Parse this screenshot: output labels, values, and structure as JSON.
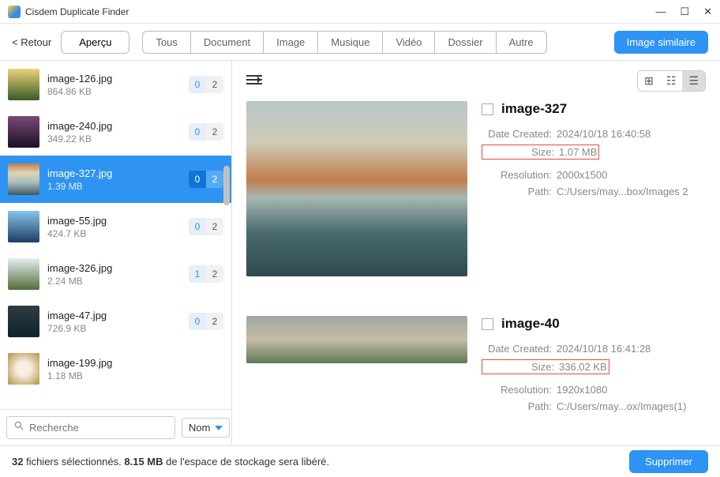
{
  "titlebar": {
    "title": "Cisdem Duplicate Finder"
  },
  "toolbar": {
    "back": "< Retour",
    "apercu": "Aperçu",
    "tabs": [
      "Tous",
      "Document",
      "Image",
      "Musique",
      "Vidéo",
      "Dossier",
      "Autre"
    ],
    "similar": "Image similaire"
  },
  "sidebar": {
    "items": [
      {
        "name": "image-126.jpg",
        "size": "864.86 KB",
        "c0": "0",
        "c1": "2"
      },
      {
        "name": "image-240.jpg",
        "size": "349.22 KB",
        "c0": "0",
        "c1": "2"
      },
      {
        "name": "image-327.jpg",
        "size": "1.39 MB",
        "c0": "0",
        "c1": "2"
      },
      {
        "name": "image-55.jpg",
        "size": "424.7 KB",
        "c0": "0",
        "c1": "2"
      },
      {
        "name": "image-326.jpg",
        "size": "2.24 MB",
        "c0": "1",
        "c1": "2"
      },
      {
        "name": "image-47.jpg",
        "size": "726.9 KB",
        "c0": "0",
        "c1": "2"
      },
      {
        "name": "image-199.jpg",
        "size": "1.18 MB",
        "c0": "",
        "c1": ""
      }
    ],
    "search_placeholder": "Recherche",
    "sort": "Nom"
  },
  "viewmode": {
    "grid": "⊞",
    "col": "☷",
    "list": "☰"
  },
  "filter_icon": "≡",
  "details": [
    {
      "title": "image-327",
      "fields": [
        {
          "k": "Date Created:",
          "v": "2024/10/18 16:40:58",
          "boxed": false
        },
        {
          "k": "Size:",
          "v": "1.07 MB",
          "boxed": true
        },
        {
          "k": "Resolution:",
          "v": "2000x1500",
          "boxed": false
        },
        {
          "k": "Path:",
          "v": "C:/Users/may...box/Images 2",
          "boxed": false
        }
      ]
    },
    {
      "title": "image-40",
      "fields": [
        {
          "k": "Date Created:",
          "v": "2024/10/18 16:41:28",
          "boxed": false
        },
        {
          "k": "Size:",
          "v": "336.02 KB",
          "boxed": true
        },
        {
          "k": "Resolution:",
          "v": "1920x1080",
          "boxed": false
        },
        {
          "k": "Path:",
          "v": "C:/Users/may...ox/Images(1)",
          "boxed": false
        }
      ]
    }
  ],
  "footer": {
    "count": "32",
    "count_suffix": " fichiers sélectionnés. ",
    "size": "8.15 MB",
    "size_suffix": "  de l'espace de stockage sera libéré.",
    "delete": "Supprimer"
  }
}
